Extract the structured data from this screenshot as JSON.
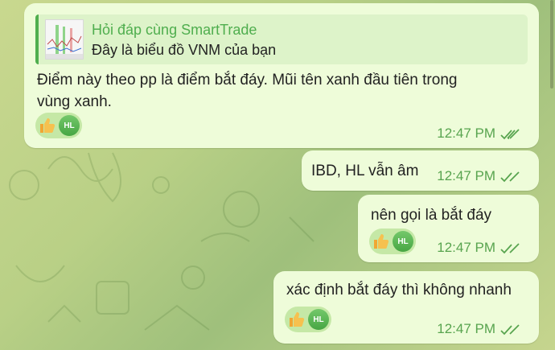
{
  "chat": {
    "messages": [
      {
        "reply_to": {
          "title": "Hỏi đáp cùng SmartTrade",
          "text": "Đây là biểu đồ VNM của bạn"
        },
        "text_line1": "Điểm này theo pp là điểm bắt đáy. Mũi tên xanh đầu tiên trong",
        "text_line2": "vùng xanh.",
        "reactions": {
          "emoji": "thumbs-up",
          "avatar": "HL"
        },
        "time": "12:47 PM"
      },
      {
        "text": "IBD, HL vẫn âm",
        "time": "12:47 PM"
      },
      {
        "text": "nên gọi là bắt đáy",
        "reactions": {
          "emoji": "thumbs-up",
          "avatar": "HL"
        },
        "time": "12:47 PM"
      },
      {
        "text": "xác định bắt đáy thì không nhanh",
        "reactions": {
          "emoji": "thumbs-up",
          "avatar": "HL"
        },
        "time": "12:47 PM"
      }
    ]
  },
  "colors": {
    "bubble": "#eefcd9",
    "accent_green": "#4fae4e",
    "time_green": "#58a44f",
    "reaction_bg": "#c5e8a6"
  }
}
